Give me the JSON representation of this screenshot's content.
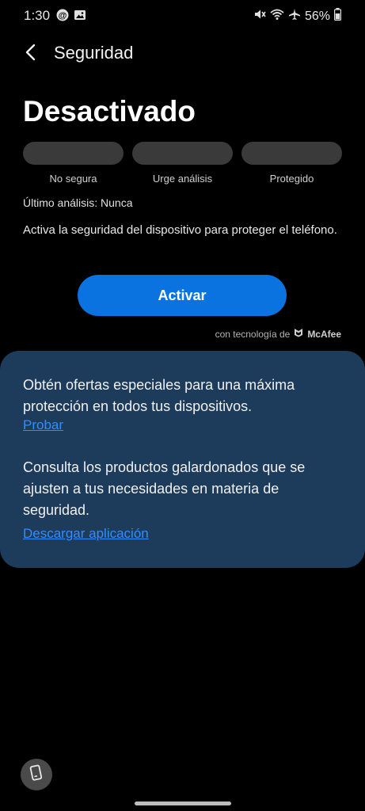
{
  "status_bar": {
    "time": "1:30",
    "battery": "56%",
    "icons": [
      "threads-icon",
      "image-icon",
      "mute-icon",
      "wifi-icon",
      "airplane-icon",
      "battery-icon"
    ]
  },
  "header": {
    "title": "Seguridad"
  },
  "security": {
    "state": "Desactivado",
    "levels": [
      "No segura",
      "Urge análisis",
      "Protegido"
    ],
    "last_scan": "Último análisis: Nunca",
    "description": "Activa la seguridad del dispositivo para proteger el teléfono.",
    "activate_label": "Activar",
    "powered_by": "con tecnología de",
    "brand": "McAfee"
  },
  "card": {
    "offer_text": "Obtén ofertas especiales para una máxima protección en todos tus dispositivos.",
    "offer_link": "Probar",
    "products_text": "Consulta los productos galardonados que se ajusten a tus necesidades en materia de seguridad.",
    "products_link": "Descargar aplicación"
  },
  "colors": {
    "accent": "#0a73e0",
    "card_bg": "#1d3b5a",
    "link": "#2f8fff",
    "progress_track": "#3a3a3a"
  }
}
